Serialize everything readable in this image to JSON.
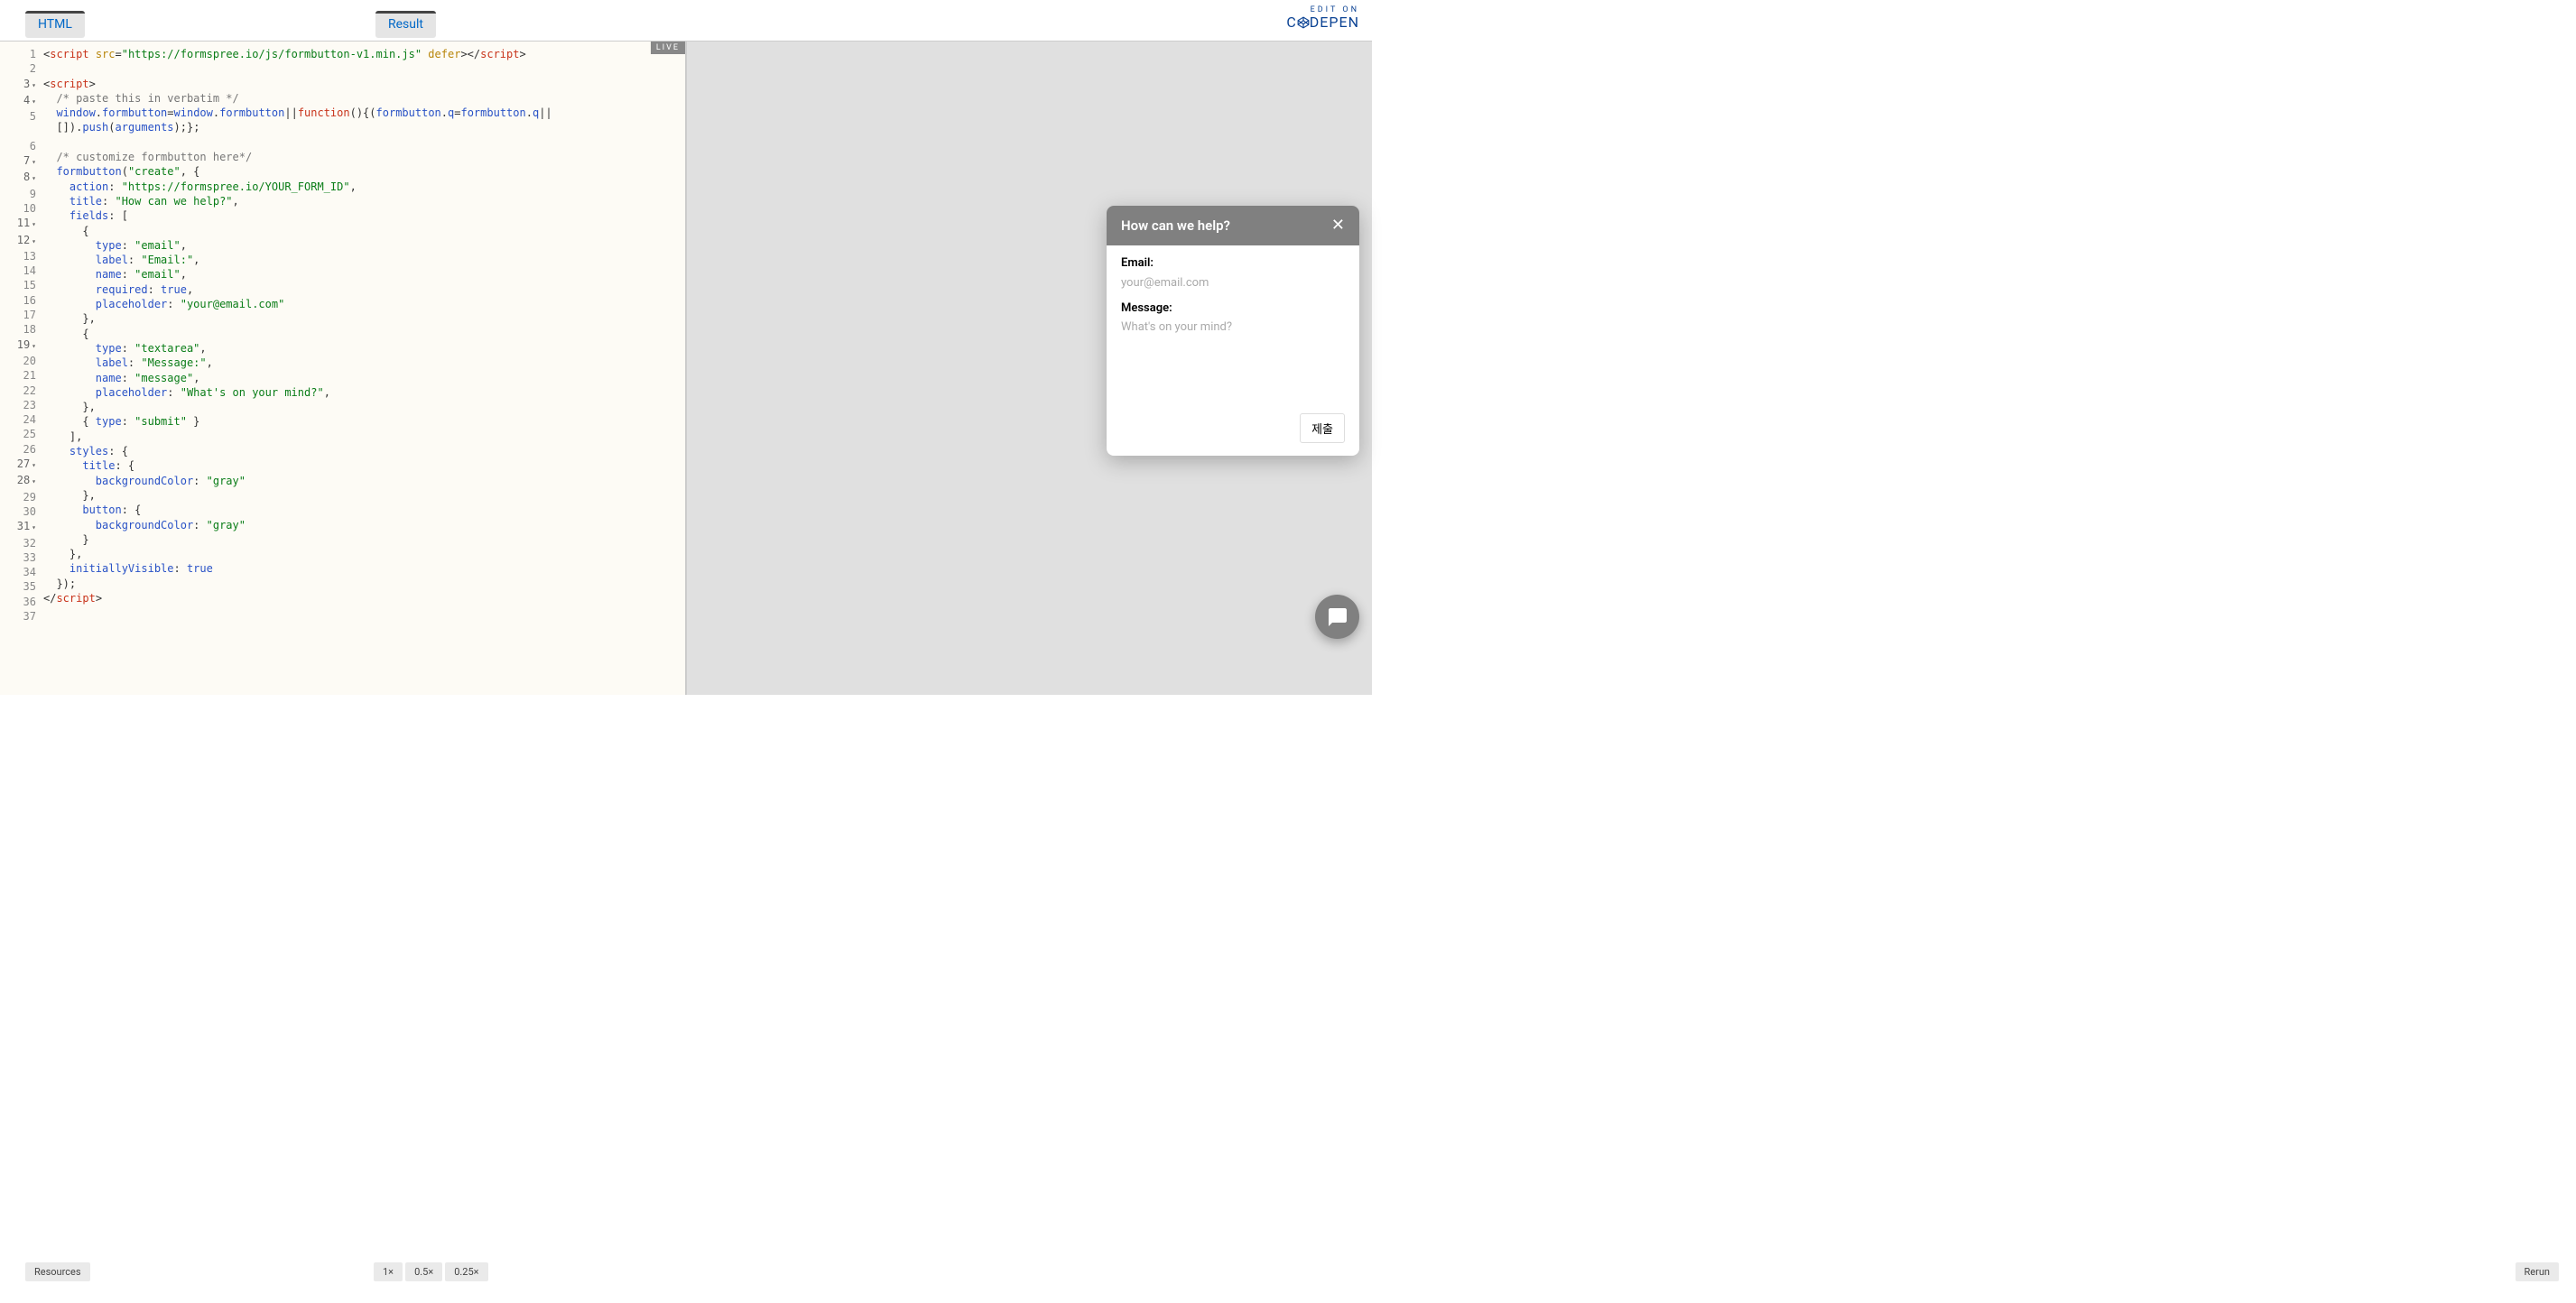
{
  "tabs": {
    "html": "HTML",
    "result": "Result"
  },
  "logo": {
    "edit": "EDIT ON",
    "brand": "C   DEPEN"
  },
  "live": "LIVE",
  "lines": [
    "1",
    "2",
    "3",
    "4",
    "5",
    "6",
    "7",
    "8",
    "9",
    "10",
    "11",
    "12",
    "13",
    "14",
    "15",
    "16",
    "17",
    "18",
    "19",
    "20",
    "21",
    "22",
    "23",
    "24",
    "25",
    "26",
    "27",
    "28",
    "29",
    "30",
    "31",
    "32",
    "33",
    "34",
    "35",
    "36",
    "37"
  ],
  "folds": [
    3,
    4,
    7,
    8,
    11,
    12,
    19,
    27,
    28,
    31
  ],
  "dialog": {
    "title": "How can we help?",
    "emailLabel": "Email:",
    "emailPh": "your@email.com",
    "msgLabel": "Message:",
    "msgPh": "What's on your mind?",
    "submit": "제출"
  },
  "footer": {
    "resources": "Resources",
    "rerun": "Rerun",
    "zoom1": "1×",
    "zoom05": "0.5×",
    "zoom025": "0.25×"
  },
  "code": {
    "l1a": "<",
    "l1b": "script",
    "l1c": " src",
    "l1d": "=",
    "l1e": "\"https://formspree.io/js/formbutton-v1.min.js\"",
    "l1f": " defer",
    "l1g": "></",
    "l1h": "script",
    "l1i": ">",
    "l3a": "<",
    "l3b": "script",
    "l3c": ">",
    "l4": "  /* paste this in verbatim */",
    "l5a": "  window",
    "l5b": ".",
    "l5c": "formbutton",
    "l5d": "=",
    "l5e": "window",
    "l5f": ".",
    "l5g": "formbutton",
    "l5h": "||",
    "l5i": "function",
    "l5j": "(){(",
    "l5k": "formbutton",
    "l5l": ".",
    "l5m": "q",
    "l5n": "=",
    "l5o": "formbutton",
    "l5p": ".",
    "l5q": "q",
    "l5r": "||",
    "l5s": "  []).",
    "l5t": "push",
    "l5u": "(",
    "l5v": "arguments",
    "l5w": ");};",
    "l7": "  /* customize formbutton here*/",
    "l8a": "  formbutton",
    "l8b": "(",
    "l8c": "\"create\"",
    "l8d": ", {",
    "l9a": "    action",
    "l9b": ": ",
    "l9c": "\"https://formspree.io/YOUR_FORM_ID\"",
    "l9d": ",",
    "l10a": "    title",
    "l10b": ": ",
    "l10c": "\"How can we help?\"",
    "l10d": ",",
    "l11a": "    fields",
    "l11b": ": [",
    "l12": "      {",
    "l13a": "        type",
    "l13b": ": ",
    "l13c": "\"email\"",
    "l13d": ",",
    "l14a": "        label",
    "l14b": ": ",
    "l14c": "\"Email:\"",
    "l14d": ",",
    "l15a": "        name",
    "l15b": ": ",
    "l15c": "\"email\"",
    "l15d": ",",
    "l16a": "        required",
    "l16b": ": ",
    "l16c": "true",
    "l16d": ",",
    "l17a": "        placeholder",
    "l17b": ": ",
    "l17c": "\"your@email.com\"",
    "l18": "      },",
    "l19": "      {",
    "l20a": "        type",
    "l20b": ": ",
    "l20c": "\"textarea\"",
    "l20d": ",",
    "l21a": "        label",
    "l21b": ": ",
    "l21c": "\"Message:\"",
    "l21d": ",",
    "l22a": "        name",
    "l22b": ": ",
    "l22c": "\"message\"",
    "l22d": ",",
    "l23a": "        placeholder",
    "l23b": ": ",
    "l23c": "\"What's on your mind?\"",
    "l23d": ",",
    "l24": "      },",
    "l25a": "      { ",
    "l25b": "type",
    "l25c": ": ",
    "l25d": "\"submit\"",
    "l25e": " }",
    "l26": "    ],",
    "l27a": "    styles",
    "l27b": ": {",
    "l28a": "      title",
    "l28b": ": {",
    "l29a": "        backgroundColor",
    "l29b": ": ",
    "l29c": "\"gray\"",
    "l30": "      },",
    "l31a": "      button",
    "l31b": ": {",
    "l32a": "        backgroundColor",
    "l32b": ": ",
    "l32c": "\"gray\"",
    "l33": "      }",
    "l34": "    },",
    "l35a": "    initiallyVisible",
    "l35b": ": ",
    "l35c": "true",
    "l36": "  });",
    "l37a": "</",
    "l37b": "script",
    "l37c": ">"
  }
}
